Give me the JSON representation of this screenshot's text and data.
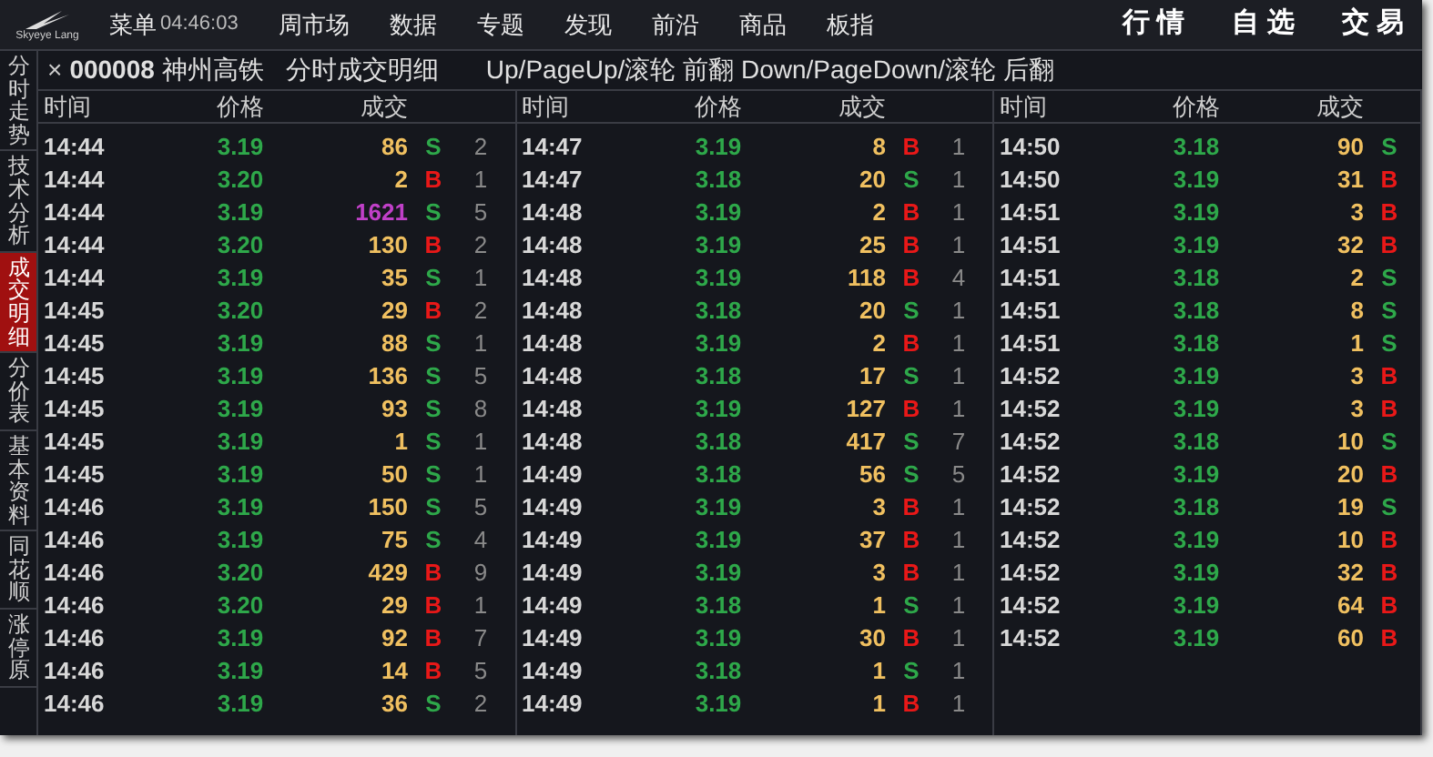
{
  "logo": {
    "text": "Skyeye Lang"
  },
  "menu": [
    "菜单",
    "04:46:03",
    "周市场",
    "数据",
    "专题",
    "发现",
    "前沿",
    "商品",
    "板指"
  ],
  "top_tabs": [
    "行 情",
    "自 选",
    "交 易"
  ],
  "sidebar": [
    {
      "label": "分时走势",
      "selected": false
    },
    {
      "label": "技术分析",
      "selected": false
    },
    {
      "label": "成交明细",
      "selected": true
    },
    {
      "label": "分价表",
      "selected": false
    },
    {
      "label": "基本资料",
      "selected": false
    },
    {
      "label": "同花顺",
      "selected": false
    },
    {
      "label": "涨停原",
      "selected": false
    }
  ],
  "header": {
    "close": "×",
    "code": "000008",
    "name": "神州高铁",
    "title": "分时成交明细",
    "hint": "Up/PageUp/滚轮 前翻 Down/PageDown/滚轮 后翻"
  },
  "panels": [
    {
      "columns": [
        "时间",
        "价格",
        "成交"
      ],
      "rows": [
        {
          "time": "14:44",
          "price": "3.19",
          "volume": "86",
          "side": "S",
          "count": "2",
          "large": false
        },
        {
          "time": "14:44",
          "price": "3.20",
          "volume": "2",
          "side": "B",
          "count": "1",
          "large": false
        },
        {
          "time": "14:44",
          "price": "3.19",
          "volume": "1621",
          "side": "S",
          "count": "5",
          "large": true
        },
        {
          "time": "14:44",
          "price": "3.20",
          "volume": "130",
          "side": "B",
          "count": "2",
          "large": false
        },
        {
          "time": "14:44",
          "price": "3.19",
          "volume": "35",
          "side": "S",
          "count": "1",
          "large": false
        },
        {
          "time": "14:45",
          "price": "3.20",
          "volume": "29",
          "side": "B",
          "count": "2",
          "large": false
        },
        {
          "time": "14:45",
          "price": "3.19",
          "volume": "88",
          "side": "S",
          "count": "1",
          "large": false
        },
        {
          "time": "14:45",
          "price": "3.19",
          "volume": "136",
          "side": "S",
          "count": "5",
          "large": false
        },
        {
          "time": "14:45",
          "price": "3.19",
          "volume": "93",
          "side": "S",
          "count": "8",
          "large": false
        },
        {
          "time": "14:45",
          "price": "3.19",
          "volume": "1",
          "side": "S",
          "count": "1",
          "large": false
        },
        {
          "time": "14:45",
          "price": "3.19",
          "volume": "50",
          "side": "S",
          "count": "1",
          "large": false
        },
        {
          "time": "14:46",
          "price": "3.19",
          "volume": "150",
          "side": "S",
          "count": "5",
          "large": false
        },
        {
          "time": "14:46",
          "price": "3.19",
          "volume": "75",
          "side": "S",
          "count": "4",
          "large": false
        },
        {
          "time": "14:46",
          "price": "3.20",
          "volume": "429",
          "side": "B",
          "count": "9",
          "large": false
        },
        {
          "time": "14:46",
          "price": "3.20",
          "volume": "29",
          "side": "B",
          "count": "1",
          "large": false
        },
        {
          "time": "14:46",
          "price": "3.19",
          "volume": "92",
          "side": "B",
          "count": "7",
          "large": false
        },
        {
          "time": "14:46",
          "price": "3.19",
          "volume": "14",
          "side": "B",
          "count": "5",
          "large": false
        },
        {
          "time": "14:46",
          "price": "3.19",
          "volume": "36",
          "side": "S",
          "count": "2",
          "large": false
        }
      ]
    },
    {
      "columns": [
        "时间",
        "价格",
        "成交"
      ],
      "rows": [
        {
          "time": "14:47",
          "price": "3.19",
          "volume": "8",
          "side": "B",
          "count": "1",
          "large": false
        },
        {
          "time": "14:47",
          "price": "3.18",
          "volume": "20",
          "side": "S",
          "count": "1",
          "large": false
        },
        {
          "time": "14:48",
          "price": "3.19",
          "volume": "2",
          "side": "B",
          "count": "1",
          "large": false
        },
        {
          "time": "14:48",
          "price": "3.19",
          "volume": "25",
          "side": "B",
          "count": "1",
          "large": false
        },
        {
          "time": "14:48",
          "price": "3.19",
          "volume": "118",
          "side": "B",
          "count": "4",
          "large": false
        },
        {
          "time": "14:48",
          "price": "3.18",
          "volume": "20",
          "side": "S",
          "count": "1",
          "large": false
        },
        {
          "time": "14:48",
          "price": "3.19",
          "volume": "2",
          "side": "B",
          "count": "1",
          "large": false
        },
        {
          "time": "14:48",
          "price": "3.18",
          "volume": "17",
          "side": "S",
          "count": "1",
          "large": false
        },
        {
          "time": "14:48",
          "price": "3.19",
          "volume": "127",
          "side": "B",
          "count": "1",
          "large": false
        },
        {
          "time": "14:48",
          "price": "3.18",
          "volume": "417",
          "side": "S",
          "count": "7",
          "large": false
        },
        {
          "time": "14:49",
          "price": "3.18",
          "volume": "56",
          "side": "S",
          "count": "5",
          "large": false
        },
        {
          "time": "14:49",
          "price": "3.19",
          "volume": "3",
          "side": "B",
          "count": "1",
          "large": false
        },
        {
          "time": "14:49",
          "price": "3.19",
          "volume": "37",
          "side": "B",
          "count": "1",
          "large": false
        },
        {
          "time": "14:49",
          "price": "3.19",
          "volume": "3",
          "side": "B",
          "count": "1",
          "large": false
        },
        {
          "time": "14:49",
          "price": "3.18",
          "volume": "1",
          "side": "S",
          "count": "1",
          "large": false
        },
        {
          "time": "14:49",
          "price": "3.19",
          "volume": "30",
          "side": "B",
          "count": "1",
          "large": false
        },
        {
          "time": "14:49",
          "price": "3.18",
          "volume": "1",
          "side": "S",
          "count": "1",
          "large": false
        },
        {
          "time": "14:49",
          "price": "3.19",
          "volume": "1",
          "side": "B",
          "count": "1",
          "large": false
        }
      ]
    },
    {
      "columns": [
        "时间",
        "价格",
        "成交"
      ],
      "rows": [
        {
          "time": "14:50",
          "price": "3.18",
          "volume": "90",
          "side": "S",
          "large": false
        },
        {
          "time": "14:50",
          "price": "3.19",
          "volume": "31",
          "side": "B",
          "large": false
        },
        {
          "time": "14:51",
          "price": "3.19",
          "volume": "3",
          "side": "B",
          "large": false
        },
        {
          "time": "14:51",
          "price": "3.19",
          "volume": "32",
          "side": "B",
          "large": false
        },
        {
          "time": "14:51",
          "price": "3.18",
          "volume": "2",
          "side": "S",
          "large": false
        },
        {
          "time": "14:51",
          "price": "3.18",
          "volume": "8",
          "side": "S",
          "large": false
        },
        {
          "time": "14:51",
          "price": "3.18",
          "volume": "1",
          "side": "S",
          "large": false
        },
        {
          "time": "14:52",
          "price": "3.19",
          "volume": "3",
          "side": "B",
          "large": false
        },
        {
          "time": "14:52",
          "price": "3.19",
          "volume": "3",
          "side": "B",
          "large": false
        },
        {
          "time": "14:52",
          "price": "3.18",
          "volume": "10",
          "side": "S",
          "large": false
        },
        {
          "time": "14:52",
          "price": "3.19",
          "volume": "20",
          "side": "B",
          "large": false
        },
        {
          "time": "14:52",
          "price": "3.18",
          "volume": "19",
          "side": "S",
          "large": false
        },
        {
          "time": "14:52",
          "price": "3.19",
          "volume": "10",
          "side": "B",
          "large": false
        },
        {
          "time": "14:52",
          "price": "3.19",
          "volume": "32",
          "side": "B",
          "large": false
        },
        {
          "time": "14:52",
          "price": "3.19",
          "volume": "64",
          "side": "B",
          "large": false
        },
        {
          "time": "14:52",
          "price": "3.19",
          "volume": "60",
          "side": "B",
          "large": false
        }
      ]
    }
  ]
}
